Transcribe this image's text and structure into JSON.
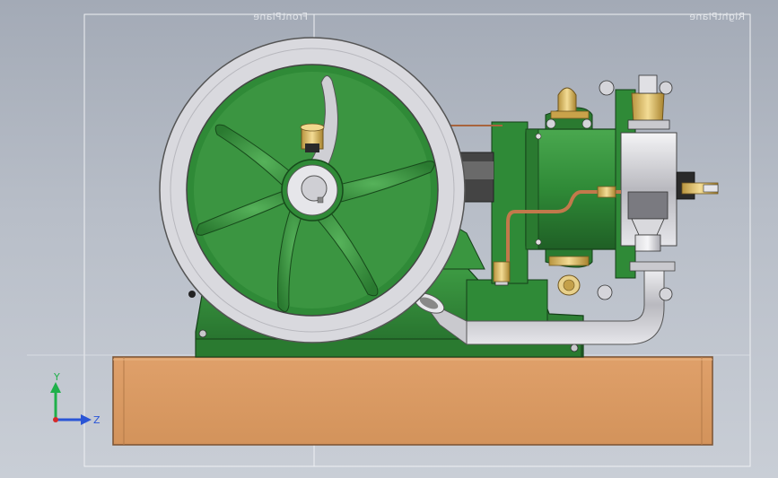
{
  "view": {
    "background_top": "#a3aab6",
    "background_bottom": "#c9ced6",
    "plane_labels": {
      "front": "FrontPlane",
      "right": "RightPlane"
    }
  },
  "triad": {
    "y_label": "Y",
    "z_label": "Z",
    "y_color": "#1fb04a",
    "z_color": "#2a55d6",
    "x_color": "#d62a2a"
  },
  "model": {
    "body_color": "#2f8a37",
    "flywheel_rim_color": "#d6d6dc",
    "base_color": "#d99b63",
    "brass_color": "#e3c57a",
    "copper_color": "#c2794b",
    "chrome_color": "#c8c8cc"
  }
}
